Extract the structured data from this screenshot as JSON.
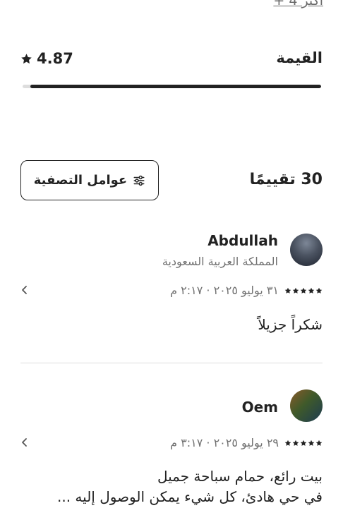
{
  "more_link": "+ 4 أكثر",
  "value_row": {
    "label": "القيمة",
    "score": "4.87",
    "fill_fraction": 0.974
  },
  "reviews_header": {
    "count": "30 تقييمًا",
    "filter_label": "عوامل التصفية"
  },
  "reviews": [
    {
      "name": "Abdullah",
      "country": "المملكة العربية السعودية",
      "stars": 5,
      "date": "٣١ يوليو ٢٠٢٥ · ٢:١٧ م",
      "text": [
        "شكراً جزيلاً"
      ]
    },
    {
      "name": "Oem",
      "stars": 5,
      "date": "٢٩ يوليو ٢٠٢٥ · ٣:١٧ م",
      "text": [
        "بيت رائع، حمام سباحة جميل",
        "في حي هادئ، كل شيء يمكن الوصول إليه ..."
      ]
    }
  ],
  "icons": {
    "star": "star-icon",
    "filter": "sliders-icon",
    "chevron": "chevron-left-icon"
  },
  "colors": {
    "text": "#222222",
    "muted": "#717171",
    "divider": "#dddddd",
    "bar_track": "#dddddd",
    "bar_fill": "#222222"
  }
}
